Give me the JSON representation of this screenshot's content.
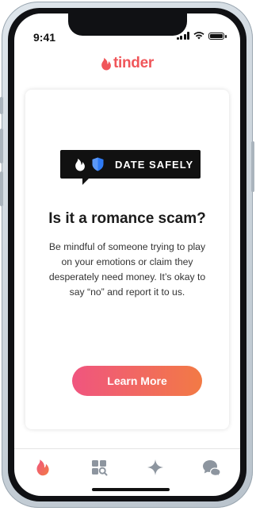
{
  "status_bar": {
    "time": "9:41"
  },
  "app": {
    "logo_text": "tinder"
  },
  "card": {
    "badge_label": "DATE SAFELY",
    "headline": "Is it a romance scam?",
    "body": "Be mindful of someone trying to play on your emotions or claim they desperately need money. It’s okay to say “no” and report it to us.",
    "cta_label": "Learn More"
  },
  "tab_bar": {
    "tabs": [
      {
        "icon": "flame-icon",
        "active": true
      },
      {
        "icon": "explore-icon",
        "active": false
      },
      {
        "icon": "sparkle-icon",
        "active": false
      },
      {
        "icon": "chat-icon",
        "active": false
      }
    ]
  },
  "colors": {
    "brand": "#f0565a",
    "cta_start": "#f0557f",
    "cta_end": "#f27a45",
    "badge_bg": "#111111",
    "shield_blue": "#2f7bf5"
  }
}
